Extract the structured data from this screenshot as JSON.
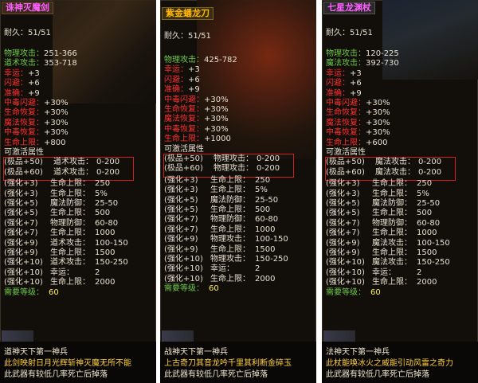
{
  "panels": [
    {
      "title": "诛神灭魔剑",
      "durability_label": "耐久：",
      "durability": "51/51",
      "base_stats": [
        {
          "label": "物理攻击：",
          "value": "251-366",
          "color": "g"
        },
        {
          "label": "道术攻击：",
          "value": "353-718",
          "color": "g"
        },
        {
          "label": "幸运：",
          "value": "+3",
          "color": "r"
        },
        {
          "label": "闪避：",
          "value": "+6",
          "color": "r"
        },
        {
          "label": "准确：",
          "value": "+9",
          "color": "r"
        },
        {
          "label": "中毒闪避：",
          "value": "+30%",
          "color": "r"
        },
        {
          "label": "生命恢复：",
          "value": "+30%",
          "color": "r"
        },
        {
          "label": "魔法恢复：",
          "value": "+30%",
          "color": "r"
        },
        {
          "label": "中毒恢复：",
          "value": "+30%",
          "color": "r"
        },
        {
          "label": "生命上限：",
          "value": "+800",
          "color": "r"
        }
      ],
      "activatable_label": "可激活属性",
      "extreme": [
        {
          "grade": "(极品+50)",
          "stat": "道术攻击：",
          "value": "0-200"
        },
        {
          "grade": "(极品+60)",
          "stat": "道术攻击：",
          "value": "0-200"
        }
      ],
      "enhance": [
        {
          "grade": "(强化+3)",
          "stat": "生命上限：",
          "value": "250"
        },
        {
          "grade": "(强化+3)",
          "stat": "生命上限：",
          "value": "5%"
        },
        {
          "grade": "(强化+5)",
          "stat": "魔法防御：",
          "value": "25-50"
        },
        {
          "grade": "(强化+5)",
          "stat": "生命上限：",
          "value": "500"
        },
        {
          "grade": "(强化+7)",
          "stat": "物理防御：",
          "value": "60-80"
        },
        {
          "grade": "(强化+7)",
          "stat": "生命上限：",
          "value": "1000"
        },
        {
          "grade": "(强化+9)",
          "stat": "道术攻击：",
          "value": "100-150"
        },
        {
          "grade": "(强化+9)",
          "stat": "生命上限：",
          "value": "1500"
        },
        {
          "grade": "(强化+10)",
          "stat": "道术攻击：",
          "value": "150-250"
        },
        {
          "grade": "(强化+10)",
          "stat": "幸运：",
          "value": "2"
        },
        {
          "grade": "(强化+10)",
          "stat": "生命上限：",
          "value": "2000"
        }
      ],
      "req_label": "需要等级：",
      "req_value": "60",
      "footer_title": "道神天下第一神兵",
      "footer_desc": "此剑映射日月光辉斩神灭魔无所不能",
      "footer_drop": "此武器有较低几率死亡后掉落"
    },
    {
      "title": "紫金蟠龙刀",
      "durability_label": "耐久：",
      "durability": "51/51",
      "base_stats": [
        {
          "label": "物理攻击：",
          "value": "425-782",
          "color": "g"
        },
        {
          "label": "幸运：",
          "value": "+3",
          "color": "r"
        },
        {
          "label": "闪避：",
          "value": "+6",
          "color": "r"
        },
        {
          "label": "准确：",
          "value": "+9",
          "color": "r"
        },
        {
          "label": "中毒闪避：",
          "value": "+30%",
          "color": "r"
        },
        {
          "label": "生命恢复：",
          "value": "+30%",
          "color": "r"
        },
        {
          "label": "魔法恢复：",
          "value": "+30%",
          "color": "r"
        },
        {
          "label": "中毒恢复：",
          "value": "+30%",
          "color": "r"
        },
        {
          "label": "生命上限：",
          "value": "+1000",
          "color": "r"
        }
      ],
      "activatable_label": "可激活属性",
      "extreme": [
        {
          "grade": "(极品+50)",
          "stat": "物理攻击：",
          "value": "0-200"
        },
        {
          "grade": "(极品+60)",
          "stat": "物理攻击：",
          "value": "0-200"
        }
      ],
      "enhance": [
        {
          "grade": "(强化+3)",
          "stat": "生命上限：",
          "value": "250"
        },
        {
          "grade": "(强化+3)",
          "stat": "生命上限：",
          "value": "5%"
        },
        {
          "grade": "(强化+5)",
          "stat": "魔法防御：",
          "value": "25-50"
        },
        {
          "grade": "(强化+5)",
          "stat": "生命上限：",
          "value": "500"
        },
        {
          "grade": "(强化+7)",
          "stat": "物理防御：",
          "value": "60-80"
        },
        {
          "grade": "(强化+7)",
          "stat": "生命上限：",
          "value": "1000"
        },
        {
          "grade": "(强化+9)",
          "stat": "物理攻击：",
          "value": "100-150"
        },
        {
          "grade": "(强化+9)",
          "stat": "生命上限：",
          "value": "1500"
        },
        {
          "grade": "(强化+10)",
          "stat": "物理攻击：",
          "value": "150-250"
        },
        {
          "grade": "(强化+10)",
          "stat": "幸运：",
          "value": "2"
        },
        {
          "grade": "(强化+10)",
          "stat": "生命上限：",
          "value": "2000"
        }
      ],
      "req_label": "需要等级：",
      "req_value": "60",
      "footer_title": "战神天下第一神兵",
      "footer_desc": "上古奇刀其音龙吟千里其利断金碎玉",
      "footer_drop": "此武器有较低几率死亡后掉落"
    },
    {
      "title": "七星龙渊杖",
      "durability_label": "耐久：",
      "durability": "51/51",
      "base_stats": [
        {
          "label": "物理攻击：",
          "value": "120-225",
          "color": "g"
        },
        {
          "label": "魔法攻击：",
          "value": "392-730",
          "color": "g"
        },
        {
          "label": "幸运：",
          "value": "+3",
          "color": "r"
        },
        {
          "label": "闪避：",
          "value": "+6",
          "color": "r"
        },
        {
          "label": "准确：",
          "value": "+9",
          "color": "r"
        },
        {
          "label": "中毒闪避：",
          "value": "+30%",
          "color": "r"
        },
        {
          "label": "生命恢复：",
          "value": "+30%",
          "color": "r"
        },
        {
          "label": "魔法恢复：",
          "value": "+30%",
          "color": "r"
        },
        {
          "label": "中毒恢复：",
          "value": "+30%",
          "color": "r"
        },
        {
          "label": "生命上限：",
          "value": "+600",
          "color": "r"
        }
      ],
      "activatable_label": "可激活属性",
      "extreme": [
        {
          "grade": "(极品+50)",
          "stat": "魔法攻击：",
          "value": "0-200"
        },
        {
          "grade": "(极品+60)",
          "stat": "魔法攻击：",
          "value": "0-200"
        }
      ],
      "enhance": [
        {
          "grade": "(强化+3)",
          "stat": "生命上限：",
          "value": "250"
        },
        {
          "grade": "(强化+3)",
          "stat": "生命上限：",
          "value": "5%"
        },
        {
          "grade": "(强化+5)",
          "stat": "魔法防御：",
          "value": "25-50"
        },
        {
          "grade": "(强化+5)",
          "stat": "生命上限：",
          "value": "500"
        },
        {
          "grade": "(强化+7)",
          "stat": "物理防御：",
          "value": "60-80"
        },
        {
          "grade": "(强化+7)",
          "stat": "生命上限：",
          "value": "1000"
        },
        {
          "grade": "(强化+9)",
          "stat": "魔法攻击：",
          "value": "100-150"
        },
        {
          "grade": "(强化+9)",
          "stat": "生命上限：",
          "value": "1500"
        },
        {
          "grade": "(强化+10)",
          "stat": "魔法攻击：",
          "value": "150-250"
        },
        {
          "grade": "(强化+10)",
          "stat": "幸运：",
          "value": "2"
        },
        {
          "grade": "(强化+10)",
          "stat": "生命上限：",
          "value": "2000"
        }
      ],
      "req_label": "需要等级：",
      "req_value": "60",
      "footer_title": "法神天下第一神兵",
      "footer_desc": "此杖能唤冰火之威能引动风雷之奇力",
      "footer_drop": "此武器有较低几率死亡后掉落"
    }
  ]
}
